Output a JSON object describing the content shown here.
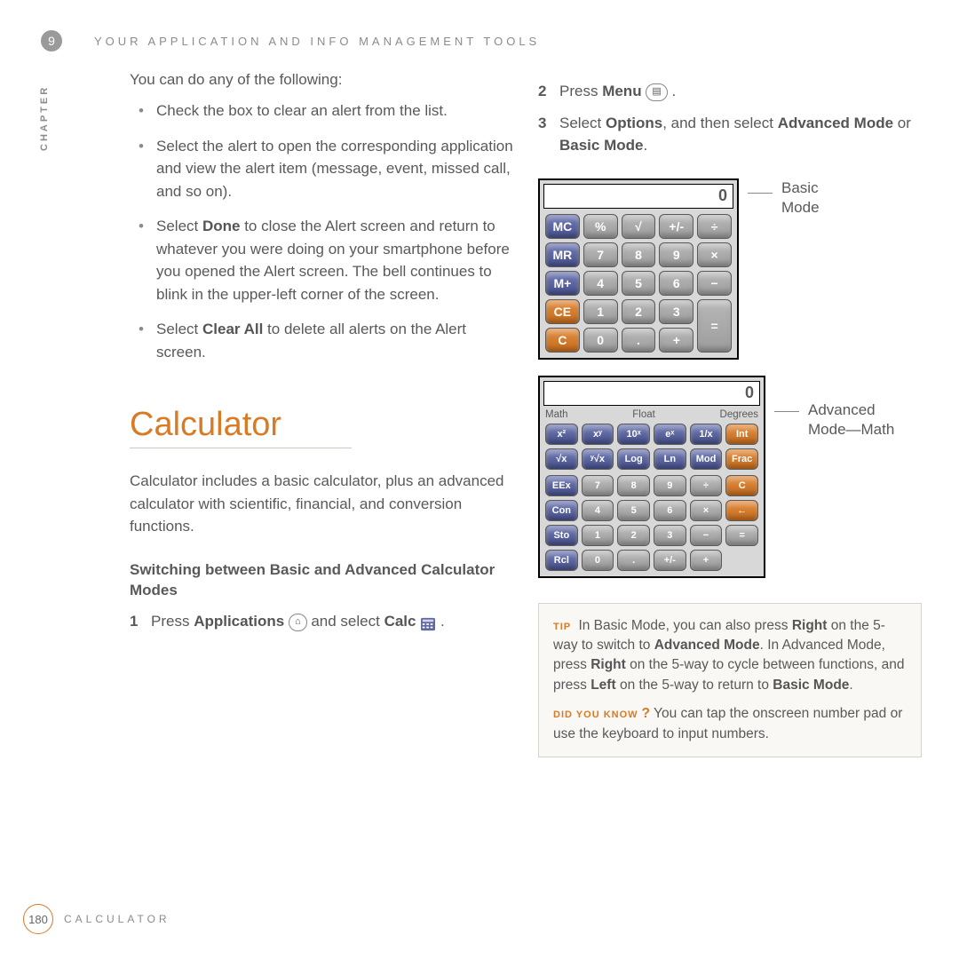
{
  "chapter_number": "9",
  "chapter_vertical": "CHAPTER",
  "top_title": "YOUR APPLICATION AND INFO MANAGEMENT TOOLS",
  "page_number": "180",
  "footer_title": "CALCULATOR",
  "left": {
    "intro": "You can do any of the following:",
    "bullets": {
      "b1": "Check the box to clear an alert from the list.",
      "b2": "Select the alert to open the corresponding application and view the alert item (message, event, missed call, and so on).",
      "b3_pre": "Select ",
      "b3_bold": "Done",
      "b3_post": " to close the Alert screen and return to whatever you were doing on your smartphone before you opened the Alert screen. The bell continues to blink in the upper-left corner of the screen.",
      "b4_pre": "Select ",
      "b4_bold": "Clear All",
      "b4_post": " to delete all alerts on the Alert screen."
    },
    "heading_calc": "Calculator",
    "calc_desc": "Calculator includes a basic calculator, plus an advanced calculator with scientific, financial, and conversion functions.",
    "subhead": "Switching between Basic and Advanced Calculator Modes",
    "step1_pre": "Press ",
    "step1_bold": "Applications",
    "step1_mid": " ",
    "step1_mid2": " and select ",
    "step1_bold2": "Calc",
    "step1_end": " ."
  },
  "right": {
    "step2_pre": "Press ",
    "step2_bold": "Menu",
    "step2_end": " .",
    "step3_pre": "Select ",
    "step3_b1": "Options",
    "step3_mid": ", and then select ",
    "step3_b2": "Advanced Mode",
    "step3_or": " or ",
    "step3_b3": "Basic Mode",
    "step3_end": ".",
    "basic_label_l1": "Basic",
    "basic_label_l2": "Mode",
    "adv_label_l1": "Advanced",
    "adv_label_l2": "Mode—Math",
    "calc_display_value": "0",
    "basic_buttons_row1": [
      "MC",
      "%",
      "√",
      "+/-",
      "÷"
    ],
    "basic_buttons_row2": [
      "MR",
      "7",
      "8",
      "9",
      "×"
    ],
    "basic_buttons_row3": [
      "M+",
      "4",
      "5",
      "6",
      "−"
    ],
    "basic_buttons_row4_a": [
      "CE",
      "1",
      "2",
      "3"
    ],
    "basic_buttons_row5_a": [
      "C",
      "0",
      ".",
      "+"
    ],
    "equals": "=",
    "adv_tabs": [
      "Math",
      "Float",
      "Degrees"
    ],
    "adv_top_row1": [
      "x²",
      "xʸ",
      "10ˣ",
      "eˣ",
      "1/x",
      "Int"
    ],
    "adv_top_row2": [
      "√x",
      "ʸ√x",
      "Log",
      "Ln",
      "Mod",
      "Frac"
    ],
    "adv_row3": [
      "EEx",
      "7",
      "8",
      "9",
      "÷",
      "C"
    ],
    "adv_row4": [
      "Con",
      "4",
      "5",
      "6",
      "×",
      "←"
    ],
    "adv_row5_a": [
      "Sto",
      "1",
      "2",
      "3",
      "−"
    ],
    "adv_row6_a": [
      "Rcl",
      "0",
      ".",
      "+/-",
      "+"
    ],
    "tip_label": "TIP",
    "tip_l1_a": " In Basic Mode, you can also press ",
    "tip_l1_bold": "Right",
    "tip_l2_a": " on the 5-way to switch to ",
    "tip_l2_bold": "Advanced Mode",
    "tip_l2_b": ". In Advanced Mode, press ",
    "tip_l2_bold2": "Right",
    "tip_l2_c": " on the 5-way to cycle between functions, and press ",
    "tip_l2_bold3": "Left",
    "tip_l2_d": " on the 5-way to return to ",
    "tip_l2_bold4": "Basic Mode",
    "tip_l2_e": ".",
    "dyk_label": "DID YOU KNOW",
    "dyk_q": "?",
    "dyk_text": " You can tap the onscreen number pad or use the keyboard to input numbers."
  }
}
